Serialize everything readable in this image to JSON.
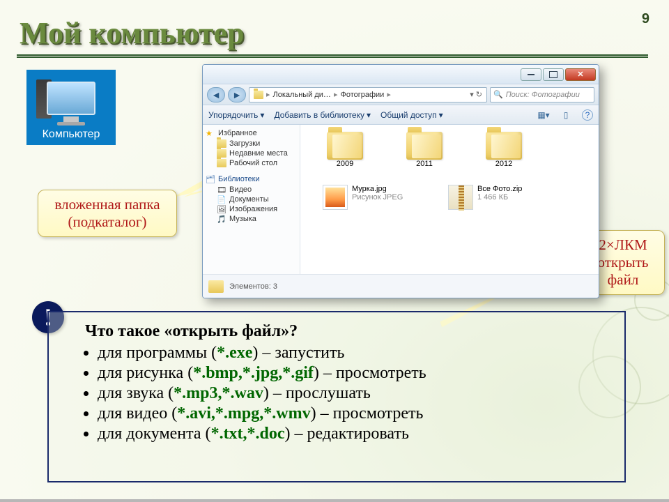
{
  "page_number": "9",
  "title": "Мой компьютер",
  "desktop_icon_label": "Компьютер",
  "callout_left_l1": "вложенная папка",
  "callout_left_l2": "(подкаталог)",
  "callout_right_l1": "2×ЛКМ",
  "callout_right_l2": "открыть",
  "callout_right_l3": "файл",
  "explorer": {
    "breadcrumb": {
      "drive": "Локальный ди…",
      "folder": "Фотографии",
      "sep": "▸"
    },
    "search_placeholder": "Поиск: Фотографии",
    "toolbar": {
      "organize": "Упорядочить",
      "addlib": "Добавить в библиотеку",
      "share": "Общий доступ"
    },
    "sidebar": {
      "favorites": "Избранное",
      "downloads": "Загрузки",
      "recent": "Недавние места",
      "desktop": "Рабочий стол",
      "libraries": "Библиотеки",
      "video": "Видео",
      "documents": "Документы",
      "pictures": "Изображения",
      "music": "Музыка"
    },
    "folders": {
      "a": "2009",
      "b": "2011",
      "c": "2012"
    },
    "files": {
      "img_name": "Мурка.jpg",
      "img_desc": "Рисунок JPEG",
      "zip_name": "Все Фото.zip",
      "zip_desc": "1 466 КБ"
    },
    "status": "Элементов: 3"
  },
  "bang": "!",
  "note": {
    "question": "Что такое «открыть файл»?",
    "li1_a": "для программы (",
    "li1_ext": "*.exe",
    "li1_b": ") – запустить",
    "li2_a": "для рисунка (",
    "li2_ext": "*.bmp,*.jpg,*.gif",
    "li2_b": ") – просмотреть",
    "li3_a": "для звука (",
    "li3_ext": "*.mp3,*.wav",
    "li3_b": ") – прослушать",
    "li4_a": "для видео (",
    "li4_ext": "*.avi,*.mpg,*.wmv",
    "li4_b": ") – просмотреть",
    "li5_a": "для документа (",
    "li5_ext": "*.txt,*.doc",
    "li5_b": ") – редактировать"
  }
}
